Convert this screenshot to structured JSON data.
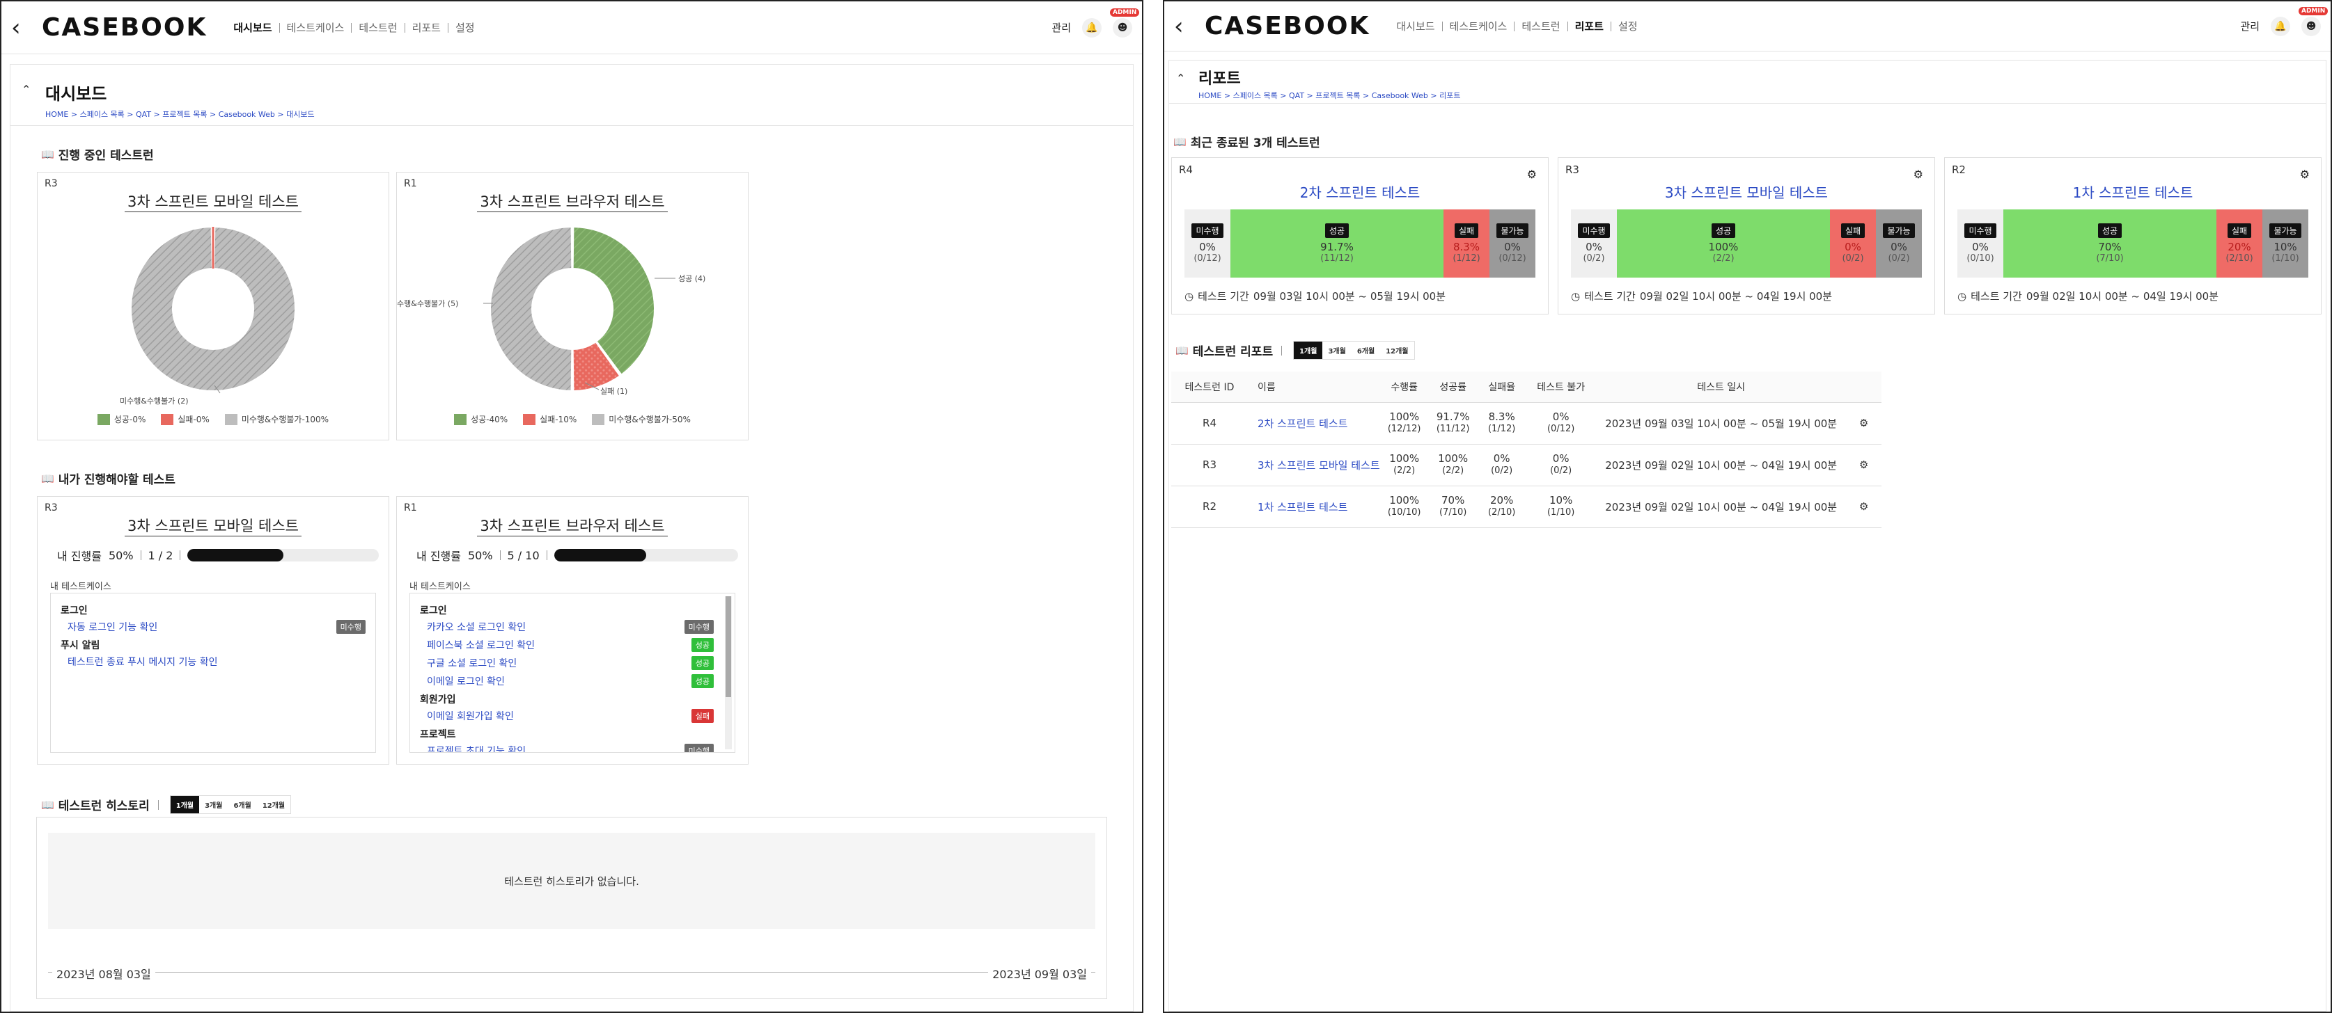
{
  "left": {
    "logo": "CASEBOOK",
    "nav": [
      "대시보드",
      "테스트케이스",
      "테스트런",
      "리포트",
      "설정"
    ],
    "nav_active": "대시보드",
    "manage": "관리",
    "admin_badge": "ADMIN",
    "page_title": "대시보드",
    "breadcrumb": "HOME > 스페이스 목록 > QAT > 프로젝트 목록 > Casebook Web > 대시보드",
    "section_ongoing": "진행 중인 테스트런",
    "section_mine": "내가 진행해야할 테스트",
    "section_history": "테스트런 히스토리",
    "ongoing": [
      {
        "rid": "R3",
        "title": "3차 스프린트 모바일 테스트",
        "slice_label": "미수행&수행불가 (2)",
        "legend": [
          "성공-0%",
          "실패-0%",
          "미수행&수행불가-100%"
        ]
      },
      {
        "rid": "R1",
        "title": "3차 스프린트 브라우저 테스트",
        "slice_labels": [
          "성공 (4)",
          "실패 (1)",
          "수행&수행불가 (5)"
        ],
        "legend": [
          "성공-40%",
          "실패-10%",
          "미수행&수행불가-50%"
        ]
      }
    ],
    "mine": [
      {
        "rid": "R3",
        "title": "3차 스프린트 모바일 테스트",
        "progress_label": "내 진행률",
        "progress_pct": "50%",
        "progress_count": "1 / 2",
        "progress_value": 0.5,
        "tc_label": "내 테스트케이스",
        "groups": [
          {
            "name": "로그인",
            "items": [
              {
                "label": "자동 로그인 기능 확인",
                "status": "미수행"
              }
            ]
          },
          {
            "name": "푸시 알림",
            "items": [
              {
                "label": "테스트런 종료 푸시 메시지 기능 확인",
                "status": ""
              }
            ]
          }
        ]
      },
      {
        "rid": "R1",
        "title": "3차 스프린트 브라우저 테스트",
        "progress_label": "내 진행률",
        "progress_pct": "50%",
        "progress_count": "5 / 10",
        "progress_value": 0.5,
        "tc_label": "내 테스트케이스",
        "groups": [
          {
            "name": "로그인",
            "items": [
              {
                "label": "카카오 소셜 로그인 확인",
                "status": "미수행"
              },
              {
                "label": "페이스북 소셜 로그인 확인",
                "status": "성공"
              },
              {
                "label": "구글 소셜 로그인 확인",
                "status": "성공"
              },
              {
                "label": "이메일 로그인 확인",
                "status": "성공"
              }
            ]
          },
          {
            "name": "회원가입",
            "items": [
              {
                "label": "이메일 회원가입 확인",
                "status": "실패"
              }
            ]
          },
          {
            "name": "프로젝트",
            "items": [
              {
                "label": "프로젝트 초대 기능 확인",
                "status": "미수행"
              }
            ]
          }
        ]
      }
    ],
    "period_tabs": [
      "1개월",
      "3개월",
      "6개월",
      "12개월"
    ],
    "period_active": "1개월",
    "history_empty": "테스트런 히스토리가 없습니다.",
    "history_start": "2023년 08월 03일",
    "history_end": "2023년 09월 03일"
  },
  "right": {
    "logo": "CASEBOOK",
    "nav": [
      "대시보드",
      "테스트케이스",
      "테스트런",
      "리포트",
      "설정"
    ],
    "nav_active": "리포트",
    "manage": "관리",
    "admin_badge": "ADMIN",
    "page_title": "리포트",
    "breadcrumb": "HOME > 스페이스 목록 > QAT > 프로젝트 목록 > Casebook Web > 리포트",
    "section_recent": "최근 종료된 3개 테스트런",
    "section_report": "테스트런 리포트",
    "period_tabs": [
      "1개월",
      "3개월",
      "6개월",
      "12개월"
    ],
    "period_active": "1개월",
    "segment_labels": {
      "untested": "미수행",
      "passed": "성공",
      "failed": "실패",
      "untestable": "불가능"
    },
    "period_prefix": "테스트 기간",
    "recent": [
      {
        "rid": "R4",
        "title": "2차 스프린트 테스트",
        "untested": [
          "0%",
          "(0/12)"
        ],
        "passed": [
          "91.7%",
          "(11/12)"
        ],
        "failed": [
          "8.3%",
          "(1/12)"
        ],
        "untestable": [
          "0%",
          "(0/12)"
        ],
        "period": "09월 03일 10시 00분 ~ 05월 19시 00분"
      },
      {
        "rid": "R3",
        "title": "3차 스프린트 모바일 테스트",
        "untested": [
          "0%",
          "(0/2)"
        ],
        "passed": [
          "100%",
          "(2/2)"
        ],
        "failed": [
          "0%",
          "(0/2)"
        ],
        "untestable": [
          "0%",
          "(0/2)"
        ],
        "period": "09월 02일 10시 00분 ~ 04일 19시 00분"
      },
      {
        "rid": "R2",
        "title": "1차 스프린트 테스트",
        "untested": [
          "0%",
          "(0/10)"
        ],
        "passed": [
          "70%",
          "(7/10)"
        ],
        "failed": [
          "20%",
          "(2/10)"
        ],
        "untestable": [
          "10%",
          "(1/10)"
        ],
        "period": "09월 02일 10시 00분 ~ 04일 19시 00분"
      }
    ],
    "table_headers": [
      "테스트런 ID",
      "이름",
      "수행률",
      "성공률",
      "실패율",
      "테스트 불가",
      "테스트 일시"
    ],
    "rows": [
      {
        "id": "R4",
        "name": "2차 스프린트 테스트",
        "exec": [
          "100%",
          "(12/12)"
        ],
        "pass": [
          "91.7%",
          "(11/12)"
        ],
        "fail": [
          "8.3%",
          "(1/12)"
        ],
        "na": [
          "0%",
          "(0/12)"
        ],
        "date": "2023년 09월 03일 10시 00분 ~ 05월 19시 00분"
      },
      {
        "id": "R3",
        "name": "3차 스프린트 모바일 테스트",
        "exec": [
          "100%",
          "(2/2)"
        ],
        "pass": [
          "100%",
          "(2/2)"
        ],
        "fail": [
          "0%",
          "(0/2)"
        ],
        "na": [
          "0%",
          "(0/2)"
        ],
        "date": "2023년 09월 02일 10시 00분 ~ 04일 19시 00분"
      },
      {
        "id": "R2",
        "name": "1차 스프린트 테스트",
        "exec": [
          "100%",
          "(10/10)"
        ],
        "pass": [
          "70%",
          "(7/10)"
        ],
        "fail": [
          "20%",
          "(2/10)"
        ],
        "na": [
          "10%",
          "(1/10)"
        ],
        "date": "2023년 09월 02일 10시 00분 ~ 04일 19시 00분"
      }
    ]
  },
  "chart_data": [
    {
      "type": "pie",
      "title": "3차 스프린트 모바일 테스트",
      "categories": [
        "성공",
        "실패",
        "미수행&수행불가"
      ],
      "values": [
        0,
        0,
        2
      ],
      "percents": [
        0,
        0,
        100
      ]
    },
    {
      "type": "pie",
      "title": "3차 스프린트 브라우저 테스트",
      "categories": [
        "성공",
        "실패",
        "미수행&수행불가"
      ],
      "values": [
        4,
        1,
        5
      ],
      "percents": [
        40,
        10,
        50
      ]
    }
  ],
  "colors": {
    "success": "#7aa862",
    "fail": "#e8685e",
    "untested": "#bdbdbd",
    "link": "#2c4bc4"
  }
}
